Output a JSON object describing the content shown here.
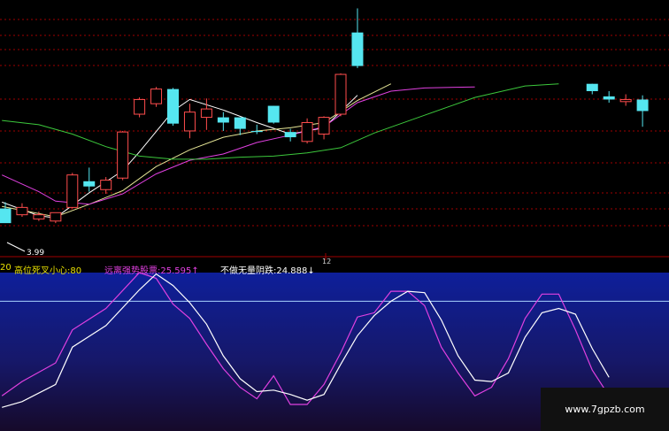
{
  "chart_data": [
    {
      "type": "candlestick",
      "price_range": [
        3.6,
        6.05
      ],
      "low_label": "3.99",
      "date_label": "12",
      "colors": {
        "up": "#ff4d4d",
        "down": "#55e6f0",
        "ma5": "#ffffff",
        "ma10": "#e6e696",
        "ma20": "#e040e0",
        "ma60": "#3cc83c",
        "grid": "#a00000"
      },
      "candles": [
        {
          "i": 0,
          "o": 4.06,
          "h": 4.12,
          "l": 3.99,
          "c": 3.92
        },
        {
          "i": 1,
          "o": 4.0,
          "h": 4.11,
          "l": 3.98,
          "c": 4.07
        },
        {
          "i": 2,
          "o": 3.96,
          "h": 4.03,
          "l": 3.94,
          "c": 4.0
        },
        {
          "i": 3,
          "o": 3.94,
          "h": 4.02,
          "l": 3.92,
          "c": 4.02
        },
        {
          "i": 4,
          "o": 4.07,
          "h": 4.4,
          "l": 4.06,
          "c": 4.38
        },
        {
          "i": 5,
          "o": 4.32,
          "h": 4.45,
          "l": 4.22,
          "c": 4.27
        },
        {
          "i": 6,
          "o": 4.24,
          "h": 4.36,
          "l": 4.2,
          "c": 4.33
        },
        {
          "i": 7,
          "o": 4.35,
          "h": 4.8,
          "l": 4.33,
          "c": 4.79
        },
        {
          "i": 8,
          "o": 4.96,
          "h": 5.12,
          "l": 4.93,
          "c": 5.1
        },
        {
          "i": 9,
          "o": 5.06,
          "h": 5.22,
          "l": 5.03,
          "c": 5.2
        },
        {
          "i": 10,
          "o": 5.2,
          "h": 5.21,
          "l": 4.85,
          "c": 4.87
        },
        {
          "i": 11,
          "o": 4.8,
          "h": 5.06,
          "l": 4.73,
          "c": 4.98
        },
        {
          "i": 12,
          "o": 4.93,
          "h": 5.11,
          "l": 4.81,
          "c": 5.01
        },
        {
          "i": 13,
          "o": 4.93,
          "h": 4.98,
          "l": 4.8,
          "c": 4.88
        },
        {
          "i": 14,
          "o": 4.93,
          "h": 4.93,
          "l": 4.76,
          "c": 4.82
        },
        {
          "i": 15,
          "o": 4.8,
          "h": 4.86,
          "l": 4.77,
          "c": 4.79
        },
        {
          "i": 16,
          "o": 5.04,
          "h": 5.04,
          "l": 4.87,
          "c": 4.88
        },
        {
          "i": 17,
          "o": 4.79,
          "h": 4.82,
          "l": 4.7,
          "c": 4.74
        },
        {
          "i": 18,
          "o": 4.7,
          "h": 4.92,
          "l": 4.68,
          "c": 4.88
        },
        {
          "i": 19,
          "o": 4.77,
          "h": 4.94,
          "l": 4.72,
          "c": 4.93
        },
        {
          "i": 20,
          "o": 4.96,
          "h": 5.35,
          "l": 4.94,
          "c": 5.34
        },
        {
          "i": 21,
          "o": 5.74,
          "h": 5.97,
          "l": 5.4,
          "c": 5.42
        },
        {
          "i": 22,
          "o": null,
          "h": null,
          "l": null,
          "c": null
        },
        {
          "i": 23,
          "o": null,
          "h": null,
          "l": null,
          "c": null
        },
        {
          "i": 24,
          "o": null,
          "h": null,
          "l": null,
          "c": null
        },
        {
          "i": 25,
          "o": null,
          "h": null,
          "l": null,
          "c": null
        },
        {
          "i": 26,
          "o": null,
          "h": null,
          "l": null,
          "c": null
        },
        {
          "i": 27,
          "o": null,
          "h": null,
          "l": null,
          "c": null
        },
        {
          "i": 28,
          "o": null,
          "h": null,
          "l": null,
          "c": null
        },
        {
          "i": 29,
          "o": null,
          "h": null,
          "l": null,
          "c": null
        },
        {
          "i": 30,
          "o": null,
          "h": null,
          "l": null,
          "c": null
        },
        {
          "i": 31,
          "o": null,
          "h": null,
          "l": null,
          "c": null
        },
        {
          "i": 32,
          "o": null,
          "h": null,
          "l": null,
          "c": null
        },
        {
          "i": 33,
          "o": null,
          "h": null,
          "l": null,
          "c": null
        },
        {
          "i": 34,
          "o": null,
          "h": null,
          "l": null,
          "c": null
        },
        {
          "i": 35,
          "o": 5.25,
          "h": 5.25,
          "l": 5.15,
          "c": 5.18
        },
        {
          "i": 36,
          "o": 5.13,
          "h": 5.18,
          "l": 5.07,
          "c": 5.1
        },
        {
          "i": 37,
          "o": 5.08,
          "h": 5.15,
          "l": 5.04,
          "c": 5.1
        },
        {
          "i": 38,
          "o": 5.1,
          "h": 5.14,
          "l": 4.84,
          "c": 4.99
        }
      ],
      "ma": [
        {
          "name": "MA5",
          "values": [
            [
              -0.2,
              4.12
            ],
            [
              2,
              3.99
            ],
            [
              3,
              3.97
            ],
            [
              5,
              4.21
            ],
            [
              7,
              4.42
            ],
            [
              8,
              4.6
            ],
            [
              10,
              4.99
            ],
            [
              11,
              5.1
            ],
            [
              13,
              5.0
            ],
            [
              15,
              4.88
            ],
            [
              17,
              4.77
            ],
            [
              19,
              4.83
            ],
            [
              21,
              5.14
            ]
          ]
        },
        {
          "name": "MA10",
          "values": [
            [
              -0.2,
              4.08
            ],
            [
              3,
              3.98
            ],
            [
              5,
              4.1
            ],
            [
              7,
              4.23
            ],
            [
              9,
              4.46
            ],
            [
              11,
              4.62
            ],
            [
              13,
              4.74
            ],
            [
              15,
              4.8
            ],
            [
              17,
              4.83
            ],
            [
              19,
              4.88
            ],
            [
              21,
              5.09
            ],
            [
              23,
              5.25
            ]
          ]
        },
        {
          "name": "MA20",
          "values": [
            [
              -0.2,
              4.38
            ],
            [
              2,
              4.22
            ],
            [
              3,
              4.13
            ],
            [
              5,
              4.1
            ],
            [
              7,
              4.2
            ],
            [
              9,
              4.39
            ],
            [
              11,
              4.52
            ],
            [
              13,
              4.58
            ],
            [
              15,
              4.69
            ],
            [
              17,
              4.76
            ],
            [
              19,
              4.84
            ],
            [
              21,
              5.07
            ],
            [
              23,
              5.18
            ],
            [
              25,
              5.21
            ],
            [
              28,
              5.22
            ]
          ]
        },
        {
          "name": "MA60",
          "values": [
            [
              -0.2,
              4.9
            ],
            [
              2,
              4.86
            ],
            [
              4,
              4.77
            ],
            [
              6,
              4.65
            ],
            [
              8,
              4.56
            ],
            [
              10,
              4.53
            ],
            [
              12,
              4.53
            ],
            [
              14,
              4.55
            ],
            [
              16,
              4.56
            ],
            [
              18,
              4.59
            ],
            [
              20,
              4.64
            ],
            [
              22,
              4.78
            ],
            [
              25,
              4.95
            ],
            [
              28,
              5.12
            ],
            [
              31,
              5.23
            ],
            [
              33,
              5.25
            ]
          ]
        }
      ]
    },
    {
      "type": "line",
      "ylim": [
        0,
        100
      ],
      "series": [
        {
          "name": "远离强势股票",
          "last_value": "25.595",
          "arrow": "↑",
          "values": [
            [
              -0.2,
              14
            ],
            [
              1,
              24
            ],
            [
              3,
              37
            ],
            [
              4,
              60
            ],
            [
              6,
              75
            ],
            [
              8,
              100
            ],
            [
              9,
              96
            ],
            [
              10,
              78
            ],
            [
              11,
              68
            ],
            [
              12,
              50
            ],
            [
              13,
              33
            ],
            [
              14,
              20
            ],
            [
              15,
              12
            ],
            [
              16,
              28
            ],
            [
              17,
              8
            ],
            [
              18,
              8
            ],
            [
              19,
              22
            ],
            [
              20,
              44
            ],
            [
              21,
              69
            ],
            [
              22,
              72
            ],
            [
              23,
              87
            ],
            [
              24,
              87
            ],
            [
              25,
              77
            ],
            [
              26,
              48
            ],
            [
              27,
              30
            ],
            [
              28,
              14
            ],
            [
              29,
              20
            ],
            [
              30,
              40
            ],
            [
              31,
              68
            ],
            [
              32,
              85
            ],
            [
              33,
              85
            ],
            [
              34,
              60
            ],
            [
              35,
              32
            ],
            [
              36,
              14
            ]
          ]
        },
        {
          "name": "不做无量阴跌",
          "last_value": "24.888",
          "arrow": "↓",
          "values": [
            [
              -0.2,
              6
            ],
            [
              1,
              10
            ],
            [
              3,
              22
            ],
            [
              4,
              48
            ],
            [
              6,
              63
            ],
            [
              8,
              88
            ],
            [
              9,
              99
            ],
            [
              10,
              91
            ],
            [
              11,
              79
            ],
            [
              12,
              64
            ],
            [
              13,
              42
            ],
            [
              14,
              26
            ],
            [
              15,
              17
            ],
            [
              16,
              18
            ],
            [
              17,
              15
            ],
            [
              18,
              11
            ],
            [
              19,
              15
            ],
            [
              20,
              36
            ],
            [
              21,
              56
            ],
            [
              22,
              70
            ],
            [
              23,
              80
            ],
            [
              24,
              87
            ],
            [
              25,
              86
            ],
            [
              26,
              67
            ],
            [
              27,
              42
            ],
            [
              28,
              25
            ],
            [
              29,
              24
            ],
            [
              30,
              30
            ],
            [
              31,
              55
            ],
            [
              32,
              72
            ],
            [
              33,
              75
            ],
            [
              34,
              71
            ],
            [
              35,
              47
            ],
            [
              36,
              27
            ]
          ]
        }
      ],
      "reference_line": 80
    }
  ],
  "indicator": {
    "period_label": "20",
    "high_cross_label": "高位死叉小心:80",
    "series1_label": "远离强势股票:25.595↑",
    "series2_label": "不做无量阴跌:24.888↓"
  },
  "watermark": "www.7gpzb.com"
}
